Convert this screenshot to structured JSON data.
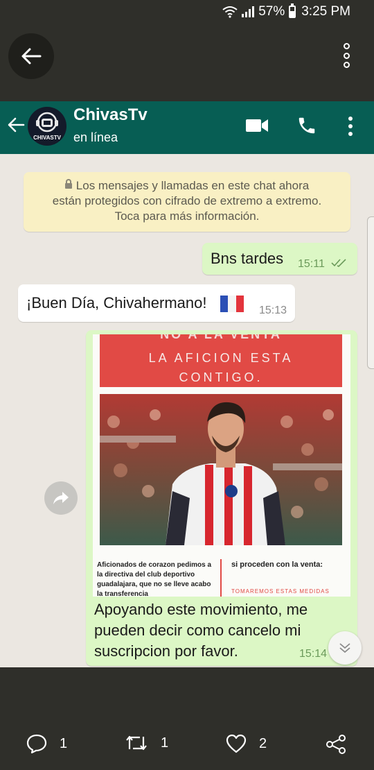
{
  "status_bar": {
    "battery": "57%",
    "time": "3:25 PM"
  },
  "chat": {
    "contact_name": "ChivasTv",
    "contact_status": "en línea",
    "avatar_text": "CHIVASTV",
    "encryption_notice": {
      "line1": "Los mensajes y llamadas en este chat ahora",
      "line2": "están protegidos con cifrado de extremo a extremo.",
      "line3": "Toca para más información."
    },
    "messages": [
      {
        "direction": "outgoing",
        "text": "Bns tardes",
        "time": "15:11",
        "read": true
      },
      {
        "direction": "incoming",
        "text": "¡Buen Día, Chivahermano!",
        "time": "15:13"
      },
      {
        "direction": "outgoing",
        "image": {
          "banner_line0": "NO A LA VENTA",
          "banner_line1": "LA AFICION ESTA",
          "banner_line2": "CONTIGO.",
          "left_text": "Aficionados de corazon pedimos a la directiva del club deportivo guadalajara, que no se lleve acabo la transferencia",
          "right_text": "si proceden con la venta:",
          "right_sub": "TOMAREMOS ESTAS MEDIDAS"
        },
        "text": "Apoyando este movimiento, me pueden decir como cancelo mi suscripcion por favor.",
        "time": "15:14"
      }
    ]
  },
  "actions": {
    "replies": "1",
    "retweets": "1",
    "likes": "2"
  },
  "colors": {
    "wa_header": "#075e54",
    "outgoing_bubble": "#dcf7c5",
    "notice_bg": "#f9f0c4"
  },
  "icons": [
    "back-arrow-icon",
    "more-vert-icon",
    "video-call-icon",
    "phone-icon",
    "lock-icon",
    "double-check-icon",
    "forward-icon",
    "chevron-down-icon",
    "reply-icon",
    "retweet-icon",
    "heart-icon",
    "share-icon"
  ]
}
